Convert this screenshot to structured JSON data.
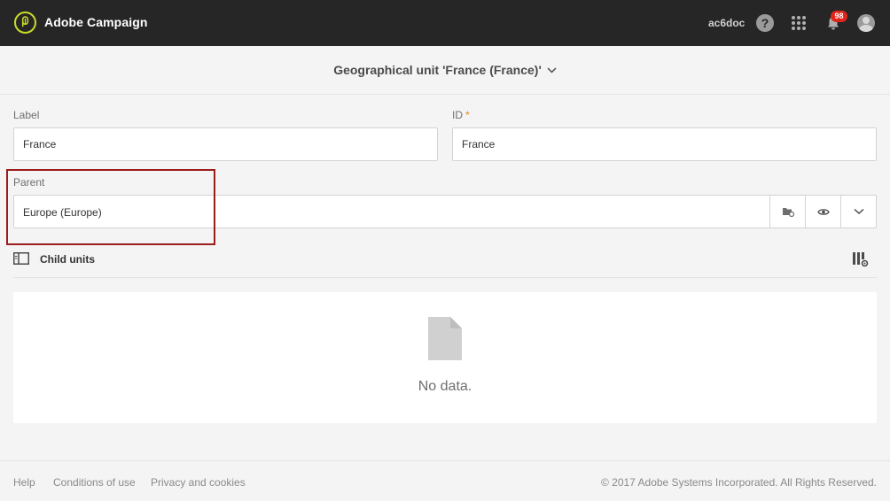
{
  "topbar": {
    "app_title": "Adobe Campaign",
    "instance": "ac6doc",
    "help_label": "?",
    "notification_count": "98",
    "accent_color": "#c8dc2a"
  },
  "header": {
    "title": "Geographical unit 'France (France)'"
  },
  "form": {
    "label_field": {
      "label": "Label",
      "value": "France"
    },
    "id_field": {
      "label": "ID",
      "required_mark": "*",
      "value": "France"
    },
    "parent_field": {
      "label": "Parent",
      "value": "Europe (Europe)"
    }
  },
  "child_units": {
    "title": "Child units",
    "empty_text": "No data."
  },
  "footer": {
    "links": [
      "Help",
      "Conditions of use",
      "Privacy and cookies"
    ],
    "copyright": "© 2017 Adobe Systems Incorporated. All Rights Reserved."
  },
  "icons": {
    "logo": "adobe-campaign-logo-icon",
    "help": "help-icon",
    "apps": "apps-grid-icon",
    "notifications": "bell-icon",
    "user": "avatar-icon",
    "title_dropdown": "chevron-down-icon",
    "parent_browse": "folder-browse-icon",
    "parent_preview": "eye-icon",
    "parent_dropdown": "chevron-down-icon",
    "child_units": "list-panel-icon",
    "configure_columns": "column-settings-icon",
    "empty_state": "document-icon"
  }
}
